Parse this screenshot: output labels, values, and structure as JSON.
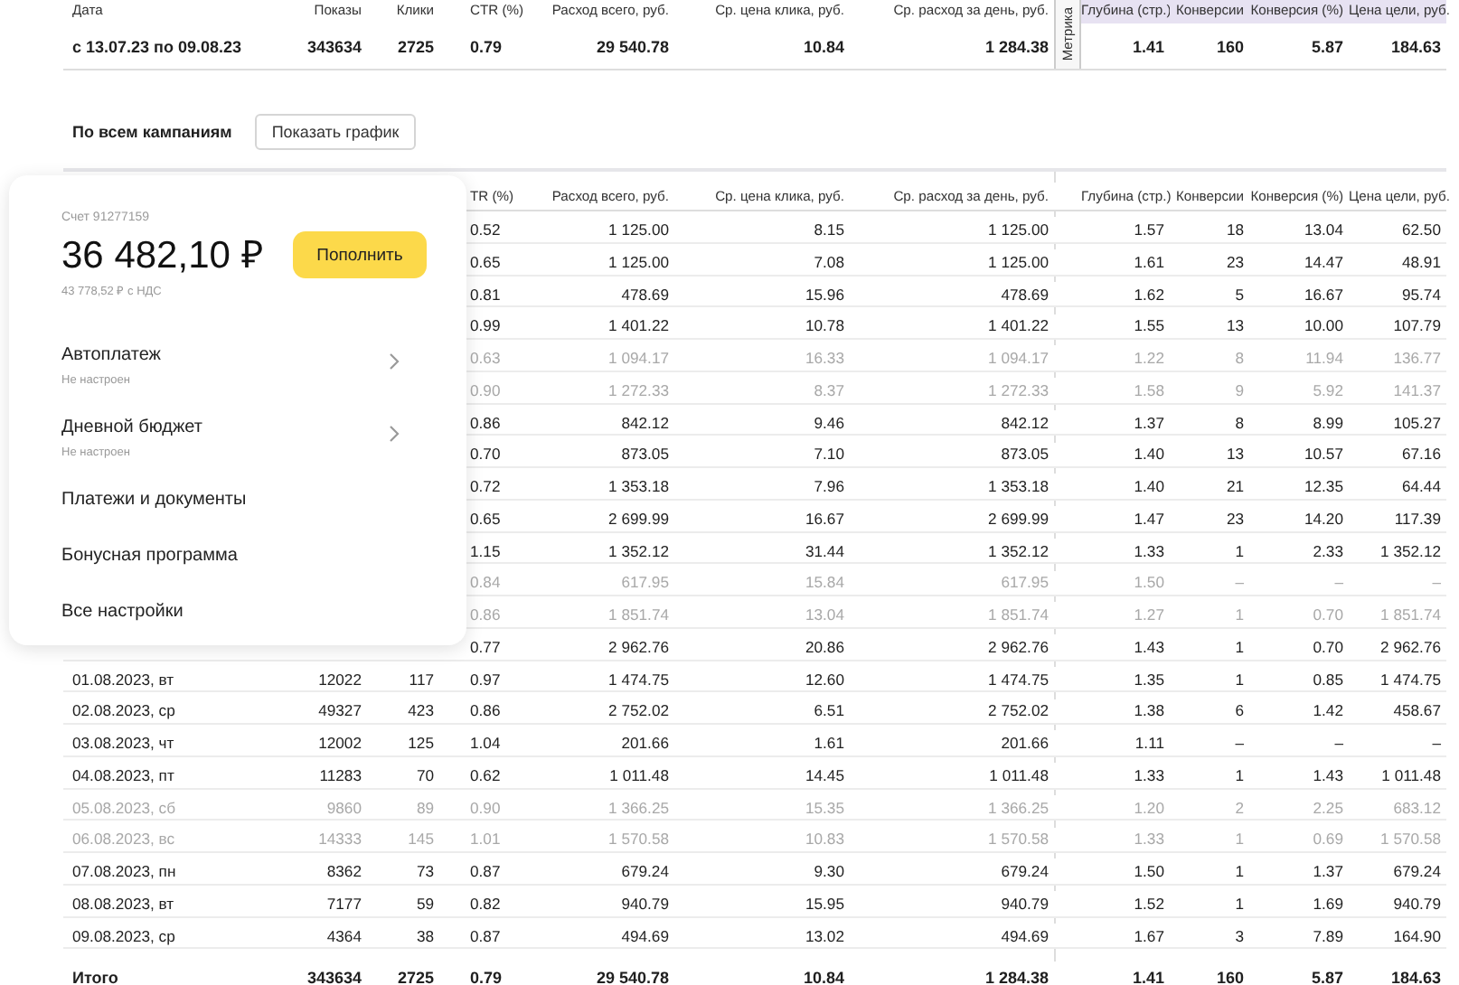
{
  "summary": {
    "columns": [
      {
        "label": "Дата",
        "highlighted": false
      },
      {
        "label": "Показы",
        "highlighted": false
      },
      {
        "label": "Клики",
        "highlighted": false
      },
      {
        "label": "CTR (%)",
        "highlighted": false
      },
      {
        "label": "Расход всего, руб.",
        "highlighted": false
      },
      {
        "label": "Ср. цена клика, руб.",
        "highlighted": false
      },
      {
        "label": "Ср. расход за день, руб.",
        "highlighted": false
      },
      {
        "label": "Глубина (стр.)",
        "highlighted": true
      },
      {
        "label": "Конверсии",
        "highlighted": true
      },
      {
        "label": "Конверсия (%)",
        "highlighted": true
      },
      {
        "label": "Цена цели, руб.",
        "highlighted": true
      }
    ],
    "side_label": "Метрика",
    "row": [
      "с 13.07.23 по 09.08.23",
      "343634",
      "2725",
      "0.79",
      "29 540.78",
      "10.84",
      "1 284.38",
      "1.41",
      "160",
      "5.87",
      "184.63"
    ]
  },
  "toolbar": {
    "title": "По всем кампаниям",
    "button": "Показать график"
  },
  "table": {
    "columns": [
      "TR (%)",
      "Расход всего, руб.",
      "Ср. цена клика, руб.",
      "Ср. расход за день, руб.",
      "Глубина (стр.)",
      "Конверсии",
      "Конверсия (%)",
      "Цена цели, руб."
    ],
    "rows": [
      {
        "dimmed": false,
        "cells": [
          "0.52",
          "1 125.00",
          "8.15",
          "1 125.00",
          "1.57",
          "18",
          "13.04",
          "62.50"
        ]
      },
      {
        "dimmed": false,
        "cells": [
          "0.65",
          "1 125.00",
          "7.08",
          "1 125.00",
          "1.61",
          "23",
          "14.47",
          "48.91"
        ]
      },
      {
        "dimmed": false,
        "cells": [
          "0.81",
          "478.69",
          "15.96",
          "478.69",
          "1.62",
          "5",
          "16.67",
          "95.74"
        ]
      },
      {
        "dimmed": false,
        "cells": [
          "0.99",
          "1 401.22",
          "10.78",
          "1 401.22",
          "1.55",
          "13",
          "10.00",
          "107.79"
        ]
      },
      {
        "dimmed": true,
        "cells": [
          "0.63",
          "1 094.17",
          "16.33",
          "1 094.17",
          "1.22",
          "8",
          "11.94",
          "136.77"
        ]
      },
      {
        "dimmed": true,
        "cells": [
          "0.90",
          "1 272.33",
          "8.37",
          "1 272.33",
          "1.58",
          "9",
          "5.92",
          "141.37"
        ]
      },
      {
        "dimmed": false,
        "cells": [
          "0.86",
          "842.12",
          "9.46",
          "842.12",
          "1.37",
          "8",
          "8.99",
          "105.27"
        ]
      },
      {
        "dimmed": false,
        "cells": [
          "0.70",
          "873.05",
          "7.10",
          "873.05",
          "1.40",
          "13",
          "10.57",
          "67.16"
        ]
      },
      {
        "dimmed": false,
        "cells": [
          "0.72",
          "1 353.18",
          "7.96",
          "1 353.18",
          "1.40",
          "21",
          "12.35",
          "64.44"
        ]
      },
      {
        "dimmed": false,
        "cells": [
          "0.65",
          "2 699.99",
          "16.67",
          "2 699.99",
          "1.47",
          "23",
          "14.20",
          "117.39"
        ]
      },
      {
        "dimmed": false,
        "cells": [
          "1.15",
          "1 352.12",
          "31.44",
          "1 352.12",
          "1.33",
          "1",
          "2.33",
          "1 352.12"
        ]
      },
      {
        "dimmed": true,
        "cells": [
          "0.84",
          "617.95",
          "15.84",
          "617.95",
          "1.50",
          "–",
          "–",
          "–"
        ]
      },
      {
        "dimmed": true,
        "cells": [
          "0.86",
          "1 851.74",
          "13.04",
          "1 851.74",
          "1.27",
          "1",
          "0.70",
          "1 851.74"
        ]
      },
      {
        "dimmed": false,
        "cells": [
          "0.77",
          "2 962.76",
          "20.86",
          "2 962.76",
          "1.43",
          "1",
          "0.70",
          "2 962.76"
        ]
      },
      {
        "dimmed": false,
        "cells": [
          "01.08.2023, вт",
          "12022",
          "117",
          "0.97",
          "1 474.75",
          "12.60",
          "1 474.75",
          "1.35",
          "1",
          "0.85",
          "1 474.75"
        ]
      },
      {
        "dimmed": false,
        "cells": [
          "02.08.2023, ср",
          "49327",
          "423",
          "0.86",
          "2 752.02",
          "6.51",
          "2 752.02",
          "1.38",
          "6",
          "1.42",
          "458.67"
        ]
      },
      {
        "dimmed": false,
        "cells": [
          "03.08.2023, чт",
          "12002",
          "125",
          "1.04",
          "201.66",
          "1.61",
          "201.66",
          "1.11",
          "–",
          "–",
          "–"
        ]
      },
      {
        "dimmed": false,
        "cells": [
          "04.08.2023, пт",
          "11283",
          "70",
          "0.62",
          "1 011.48",
          "14.45",
          "1 011.48",
          "1.33",
          "1",
          "1.43",
          "1 011.48"
        ]
      },
      {
        "dimmed": true,
        "cells": [
          "05.08.2023, сб",
          "9860",
          "89",
          "0.90",
          "1 366.25",
          "15.35",
          "1 366.25",
          "1.20",
          "2",
          "2.25",
          "683.12"
        ]
      },
      {
        "dimmed": true,
        "cells": [
          "06.08.2023, вс",
          "14333",
          "145",
          "1.01",
          "1 570.58",
          "10.83",
          "1 570.58",
          "1.33",
          "1",
          "0.69",
          "1 570.58"
        ]
      },
      {
        "dimmed": false,
        "cells": [
          "07.08.2023, пн",
          "8362",
          "73",
          "0.87",
          "679.24",
          "9.30",
          "679.24",
          "1.50",
          "1",
          "1.37",
          "679.24"
        ]
      },
      {
        "dimmed": false,
        "cells": [
          "08.08.2023, вт",
          "7177",
          "59",
          "0.82",
          "940.79",
          "15.95",
          "940.79",
          "1.52",
          "1",
          "1.69",
          "940.79"
        ]
      },
      {
        "dimmed": false,
        "cells": [
          "09.08.2023, ср",
          "4364",
          "38",
          "0.87",
          "494.69",
          "13.02",
          "494.69",
          "1.67",
          "3",
          "7.89",
          "164.90"
        ]
      }
    ],
    "total": [
      "Итого",
      "343634",
      "2725",
      "0.79",
      "29 540.78",
      "10.84",
      "1 284.38",
      "1.41",
      "160",
      "5.87",
      "184.63"
    ]
  },
  "account_popup": {
    "account": "Счет 91277159",
    "balance": "36 482,10 ₽",
    "balance_vat": "43 778,52 ₽ с НДС",
    "button": "Пополнить",
    "items": [
      {
        "kind": "submenu",
        "label": "Автоплатеж",
        "status": "Не настроен"
      },
      {
        "kind": "submenu",
        "label": "Дневной бюджет",
        "status": "Не настроен"
      },
      {
        "kind": "link",
        "label": "Платежи и документы"
      },
      {
        "kind": "link",
        "label": "Бонусная программа"
      },
      {
        "kind": "link",
        "label": "Все настройки"
      }
    ]
  }
}
